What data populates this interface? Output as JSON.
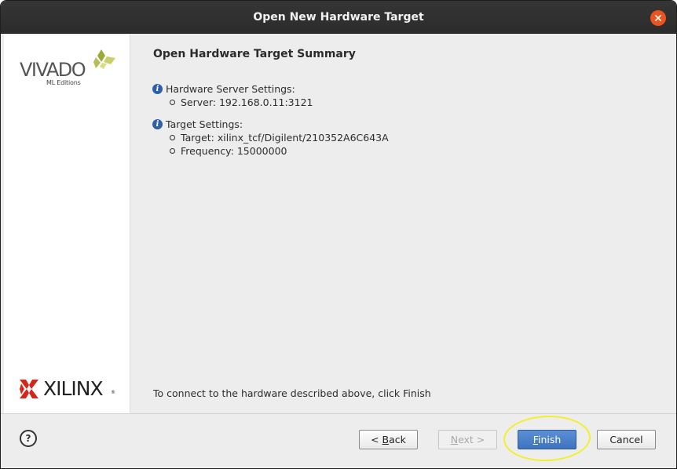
{
  "window": {
    "title": "Open New Hardware Target"
  },
  "branding": {
    "vivado_word": "VIVADO",
    "vivado_sub": "ML Editions",
    "xilinx_word": "XILINX",
    "xilinx_reg": "®"
  },
  "summary": {
    "title": "Open Hardware Target Summary",
    "server_section": {
      "heading": "Hardware Server Settings:",
      "items": [
        "Server: 192.168.0.11:3121"
      ]
    },
    "target_section": {
      "heading": "Target Settings:",
      "items": [
        "Target: xilinx_tcf/Digilent/210352A6C643A",
        "Frequency: 15000000"
      ]
    },
    "footer_message": "To connect to the hardware described above, click Finish"
  },
  "buttons": {
    "help": "?",
    "back_prefix": "< ",
    "back_mnemonic": "B",
    "back_rest": "ack",
    "next_mnemonic": "N",
    "next_rest": "ext >",
    "finish_mnemonic": "F",
    "finish_rest": "inish",
    "cancel": "Cancel"
  },
  "colors": {
    "titlebar": "#2f2f2f",
    "close_button": "#e95420",
    "primary_button": "#4a7fcb",
    "info_icon": "#2f5fa8",
    "highlight_annotation": "#f3ef2b",
    "vivado_leaf_green": "#9aab3a",
    "xilinx_red": "#d4261d"
  }
}
